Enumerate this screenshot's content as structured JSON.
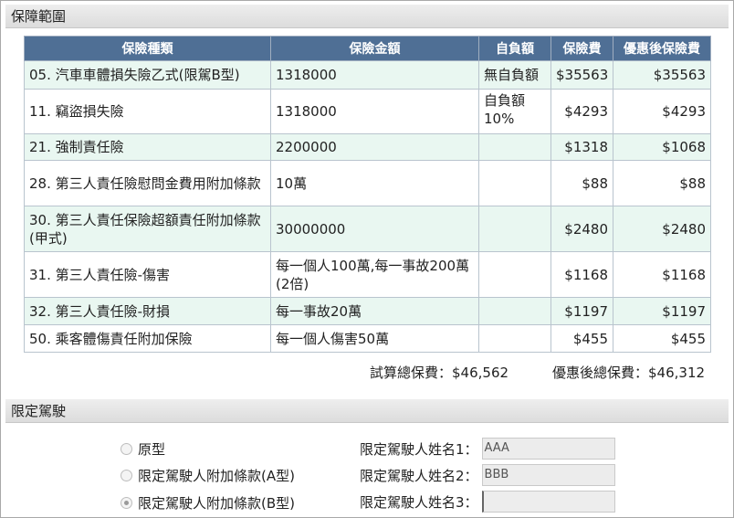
{
  "coverage": {
    "title": "保障範圍",
    "headers": [
      "保險種類",
      "保險金額",
      "自負額",
      "保險費",
      "優惠後保險費"
    ],
    "rows": [
      {
        "type": "05. 汽車車體損失險乙式(限駕B型)",
        "amount": "1318000",
        "deductible": "無自負額",
        "premium": "$35563",
        "discounted": "$35563"
      },
      {
        "type": "11. 竊盜損失險",
        "amount": "1318000",
        "deductible": "自負額10%",
        "premium": "$4293",
        "discounted": "$4293"
      },
      {
        "type": "21. 強制責任險",
        "amount": "2200000",
        "deductible": "",
        "premium": "$1318",
        "discounted": "$1068"
      },
      {
        "type": "28. 第三人責任險慰問金費用附加條款",
        "amount": "10萬",
        "deductible": "",
        "premium": "$88",
        "discounted": "$88"
      },
      {
        "type": "30. 第三人責任保險超額責任附加條款(甲式)",
        "amount": "30000000",
        "deductible": "",
        "premium": "$2480",
        "discounted": "$2480"
      },
      {
        "type": "31. 第三人責任險-傷害",
        "amount": "每一個人100萬,每一事故200萬(2倍)",
        "deductible": "",
        "premium": "$1168",
        "discounted": "$1168"
      },
      {
        "type": "32. 第三人責任險-財損",
        "amount": "每一事故20萬",
        "deductible": "",
        "premium": "$1197",
        "discounted": "$1197"
      },
      {
        "type": "50. 乘客體傷責任附加保險",
        "amount": "每一個人傷害50萬",
        "deductible": "",
        "premium": "$455",
        "discounted": "$455"
      }
    ],
    "total_label": "試算總保費：$46,562",
    "discount_total_label": "優惠後總保費：$46,312"
  },
  "driver": {
    "title": "限定駕駛",
    "options": [
      {
        "label": "原型",
        "checked": false
      },
      {
        "label": "限定駕駛人附加條款(A型)",
        "checked": false
      },
      {
        "label": "限定駕駛人附加條款(B型)",
        "checked": true
      }
    ],
    "names": [
      {
        "label": "限定駕駛人姓名1：",
        "value": "AAA"
      },
      {
        "label": "限定駕駛人姓名2：",
        "value": "BBB"
      },
      {
        "label": "限定駕駛人姓名3：",
        "value": ""
      }
    ]
  },
  "colors": {
    "header_bg": "#4f6f95",
    "row_alt": "#e9f7f1"
  }
}
